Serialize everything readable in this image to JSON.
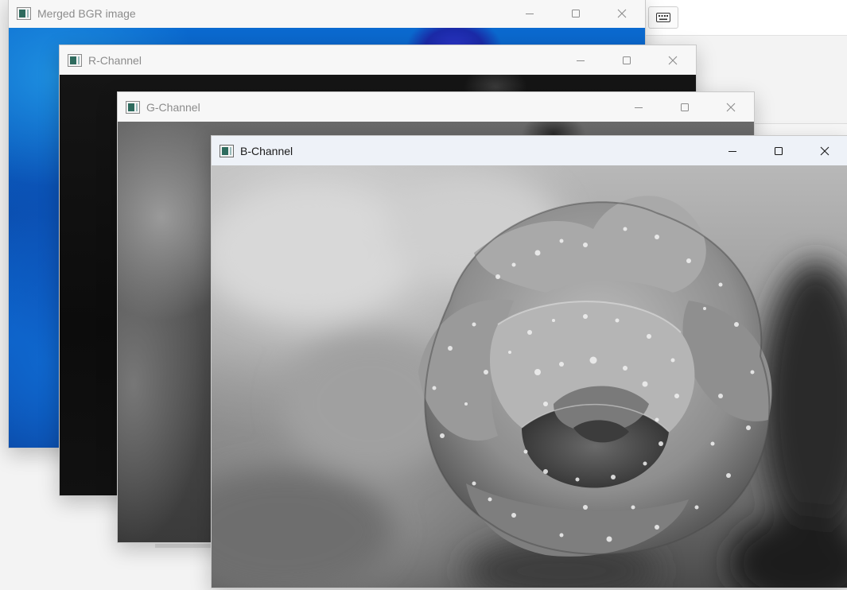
{
  "windows": {
    "merged": {
      "title": "Merged BGR image",
      "icon": "app-image-icon"
    },
    "r": {
      "title": "R-Channel",
      "icon": "app-image-icon"
    },
    "g": {
      "title": "G-Channel",
      "icon": "app-image-icon"
    },
    "b": {
      "title": "B-Channel",
      "icon": "app-image-icon"
    }
  },
  "controls": {
    "minimize_icon": "minimize-icon",
    "maximize_icon": "maximize-icon",
    "close_icon": "close-icon"
  },
  "background_app": {
    "button_icon": "keyboard-icon"
  },
  "colors": {
    "active_titlebar": "#eef2f8",
    "inactive_titlebar": "#f7f7f7",
    "inactive_title_text": "#8c8c8c",
    "active_title_text": "#1a1a1a",
    "desktop": "#f3f3f3"
  }
}
